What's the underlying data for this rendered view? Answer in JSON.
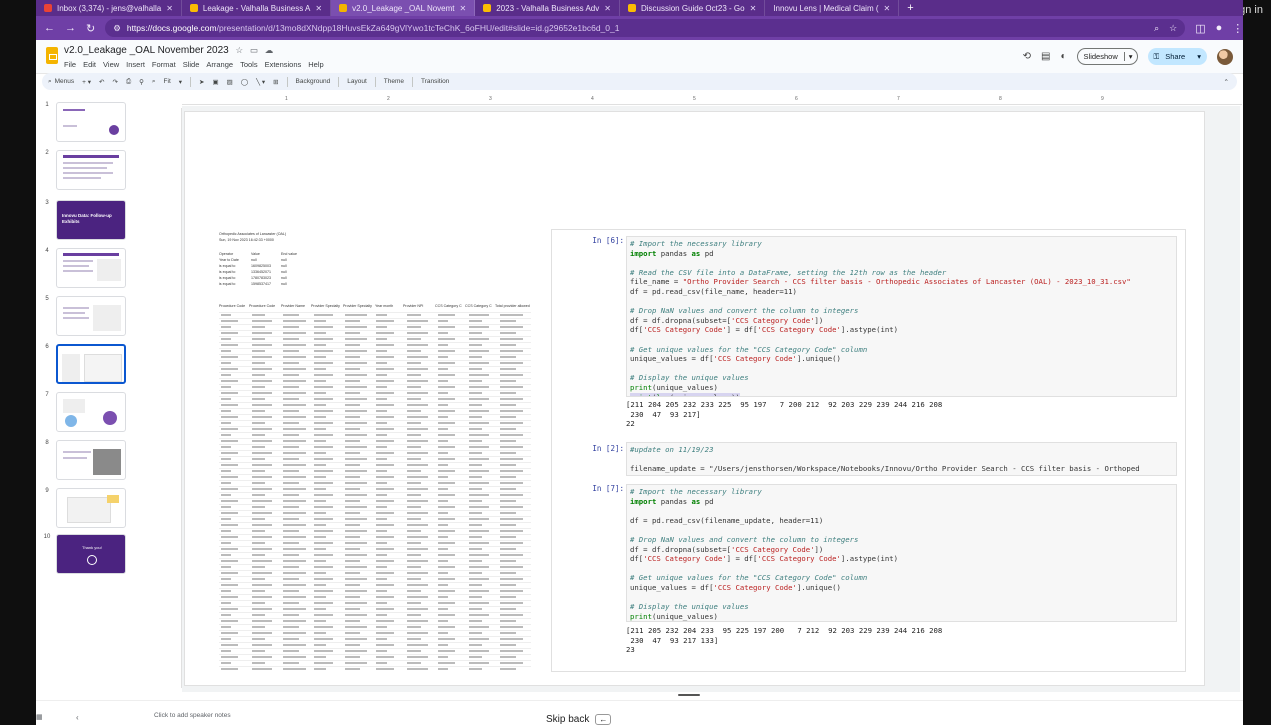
{
  "browser": {
    "tabs": [
      {
        "label": "Inbox (3,374) - jens@valhalla",
        "color": "#ea4335"
      },
      {
        "label": "Leakage - Valhalla Business A",
        "color": "#fbbc04"
      },
      {
        "label": "v2.0_Leakage _OAL Novemt",
        "color": "#f4b400",
        "active": true
      },
      {
        "label": "2023 - Valhalla Business Adv",
        "color": "#fbbc04"
      },
      {
        "label": "Discussion Guide Oct23 - Go",
        "color": "#4285f4"
      },
      {
        "label": "Innovu Lens | Medical Claim (",
        "color": "#888888"
      }
    ],
    "url_host": "https://docs.google.com",
    "url_path": "/presentation/d/13mo8dXNdpp18HuvsEkZa649gVlYwo1tcTeChK_6oFHU/edit#slide=id.g29652e1bc6d_0_1",
    "sign_in": "Sign in"
  },
  "docs": {
    "title": "v2.0_Leakage _OAL November 2023",
    "menus": [
      "File",
      "Edit",
      "View",
      "Insert",
      "Format",
      "Slide",
      "Arrange",
      "Tools",
      "Extensions",
      "Help"
    ],
    "slideshow_label": "Slideshow",
    "share_label": "Share"
  },
  "toolbar": {
    "menus_label": "Menus",
    "fit_label": "Fit",
    "background_label": "Background",
    "layout_label": "Layout",
    "theme_label": "Theme",
    "transition_label": "Transition"
  },
  "filmstrip": {
    "slides": [
      {
        "num": "1"
      },
      {
        "num": "2"
      },
      {
        "num": "3",
        "title": "Innovu Data: Follow-up Exhibits"
      },
      {
        "num": "4"
      },
      {
        "num": "5"
      },
      {
        "num": "6",
        "selected": true
      },
      {
        "num": "7"
      },
      {
        "num": "8"
      },
      {
        "num": "9"
      },
      {
        "num": "10",
        "title": "Thank you!"
      }
    ]
  },
  "ruler": [
    "1",
    "2",
    "3",
    "4",
    "5",
    "6",
    "7",
    "8",
    "9"
  ],
  "sheet": {
    "title": "Orthopedic Associates of Lancaster (OAL)",
    "date": "Sun, 19 Nov 2023 16:42:33 +0000",
    "params_header": [
      "Operator",
      "Value",
      "End value"
    ],
    "params": [
      [
        "Year to Date",
        "null",
        "null"
      ],
      [
        "is equal to",
        "1609825003",
        "null"
      ],
      [
        "is equal to",
        "1336452071",
        "null"
      ],
      [
        "is equal to",
        "1780783023",
        "null"
      ],
      [
        "is equal to",
        "1598537417",
        "null"
      ]
    ],
    "columns": [
      "Procedure Code",
      "Procedure Code",
      "Provider Name",
      "Provider Specialty",
      "Provider Specialty",
      "Year month",
      "Provider NPI",
      "CCS Category C",
      "CCS Category C",
      "Total provider allowed"
    ]
  },
  "notebook": {
    "cell6_prompt": "In [6]:",
    "cell6_output": "[211 204 205 232 233 225  95 197   7 200 212  92 203 229 239 244 216 208\n 230  47  93 217]\n22",
    "cell2_prompt": "In [2]:",
    "cell2_comment": "#update on 11/19/23",
    "cell2_code": "filename_update = \"/Users/jensthorsen/Workspace/Notebooks/Innovu/Ortho Provider Search - CCS filter basis - Orthoped",
    "cell7_prompt": "In [7]:",
    "cell7_output": "[211 205 232 204 233  95 225 197 200   7 212  92 203 229 239 244 216 208\n 230  47  93 217 133]\n23"
  },
  "notes": {
    "hint": "Click to add speaker notes",
    "skip_back": "Skip back"
  }
}
